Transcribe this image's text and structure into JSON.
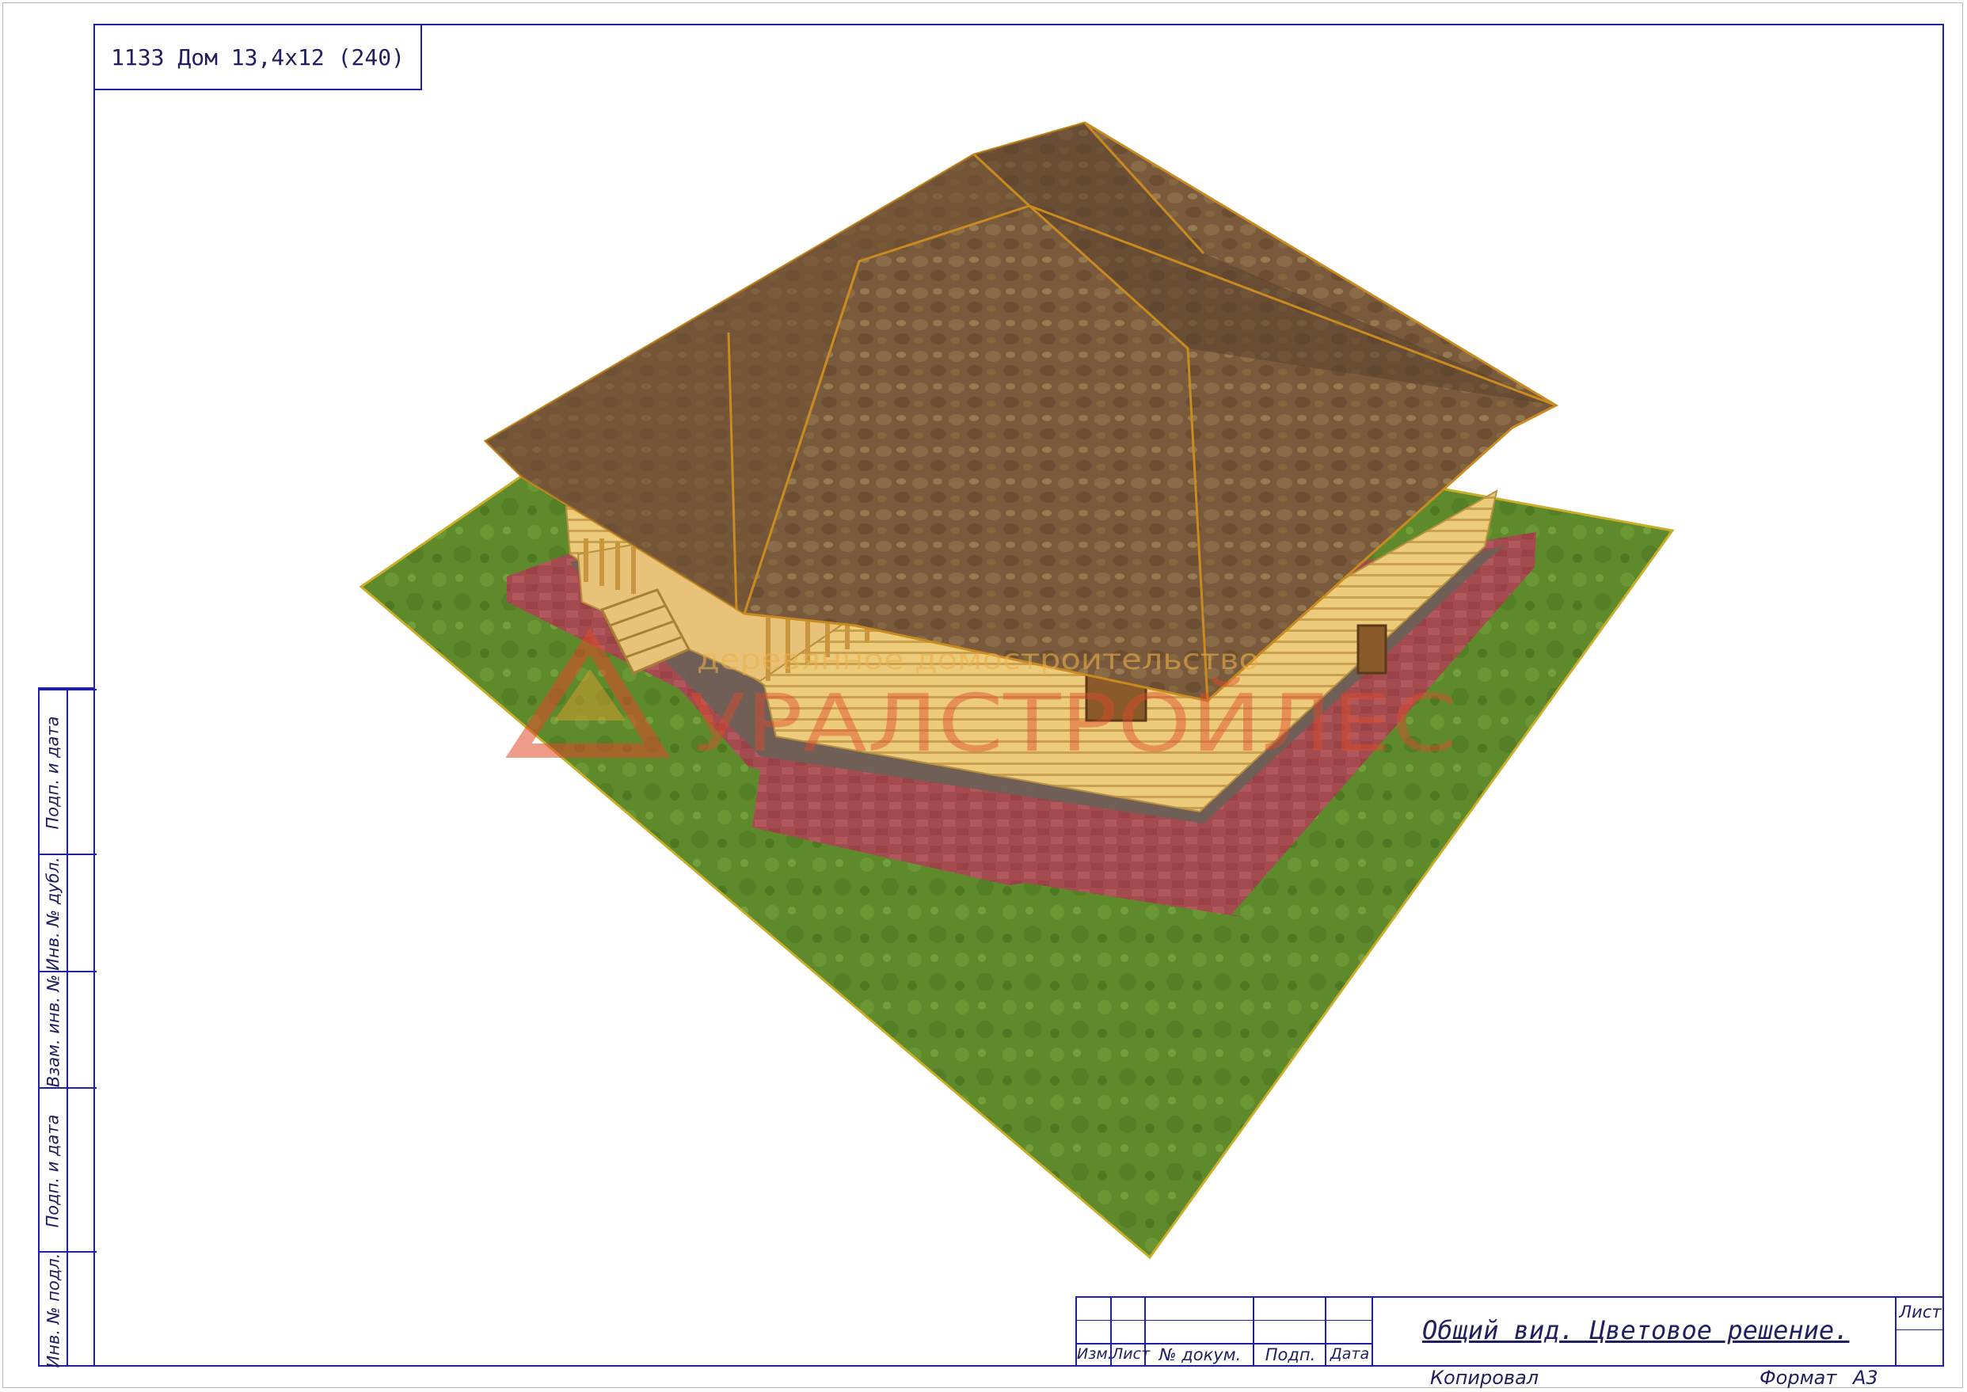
{
  "sheet": {
    "title": "1133 Дом 13,4х12 (240)"
  },
  "side_stamp": {
    "fields": [
      "Подп. и дата",
      "Инв. № дубл.",
      "Взам. инв. №",
      "Подп. и дата",
      "Инв. № подл."
    ]
  },
  "title_block": {
    "columns": [
      "Изм.",
      "Лист",
      "№ докум.",
      "Подп.",
      "Дата"
    ],
    "document_title": "Общий вид. Цветовое решение.",
    "sheet_label": "Лист",
    "copied_label": "Копировал",
    "format_label": "Формат",
    "format_value": "А3"
  },
  "watermark": {
    "tagline": "деревянное домостроительство",
    "brand": "УРАЛСТРОЙЛЕС"
  },
  "colors": {
    "frame": "#1f1fa8",
    "grass": "#5f8a2c",
    "paving": "#a54a4e",
    "roof": "#7a5a3a",
    "logs": "#e8c070",
    "watermark": "#e24a2a"
  }
}
